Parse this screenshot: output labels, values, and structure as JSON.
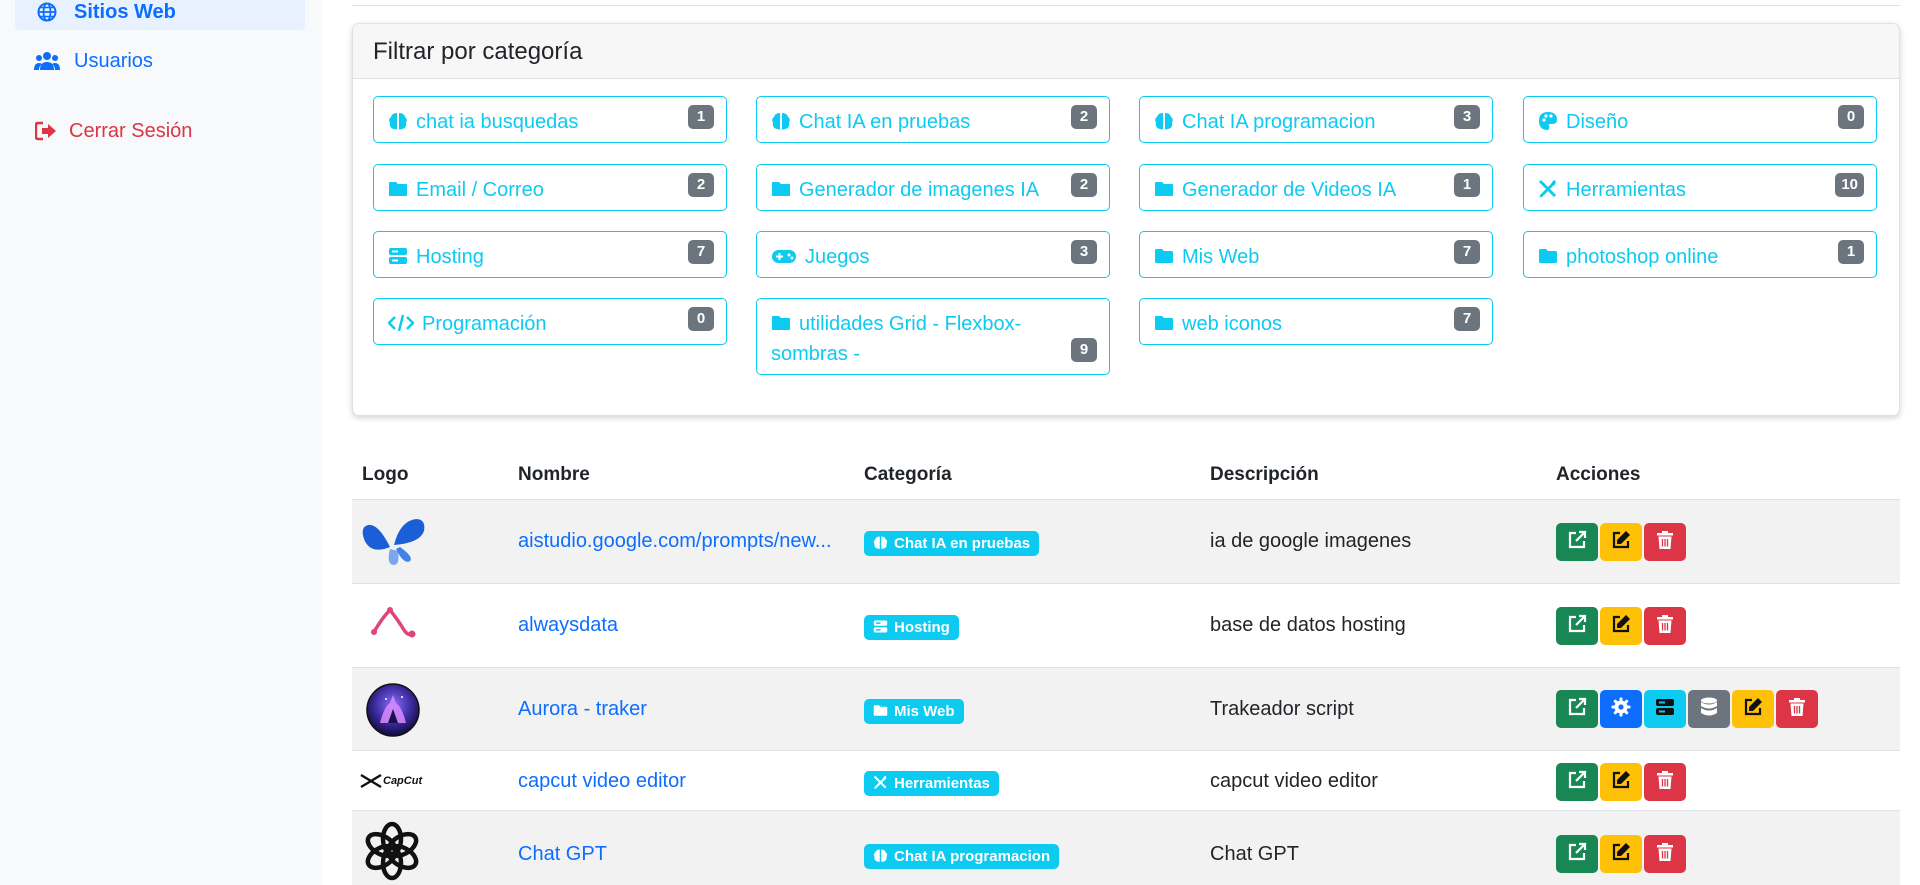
{
  "sidebar": {
    "items": [
      {
        "label": "Sitios Web",
        "icon": "globe-icon"
      },
      {
        "label": "Usuarios",
        "icon": "users-icon"
      },
      {
        "label": "Cerrar Sesión",
        "icon": "logout-icon"
      }
    ]
  },
  "filter": {
    "title": "Filtrar por categoría",
    "categories": [
      {
        "label": "chat ia busquedas",
        "count": "1",
        "icon": "brain-icon"
      },
      {
        "label": "Chat IA en pruebas",
        "count": "2",
        "icon": "brain-icon"
      },
      {
        "label": "Chat IA programacion",
        "count": "3",
        "icon": "brain-icon"
      },
      {
        "label": "Diseño",
        "count": "0",
        "icon": "palette-icon"
      },
      {
        "label": "Email / Correo",
        "count": "2",
        "icon": "folder-icon"
      },
      {
        "label": "Generador de imagenes IA",
        "count": "2",
        "icon": "folder-icon"
      },
      {
        "label": "Generador de Videos IA",
        "count": "1",
        "icon": "folder-icon"
      },
      {
        "label": "Herramientas",
        "count": "10",
        "icon": "tools-icon"
      },
      {
        "label": "Hosting",
        "count": "7",
        "icon": "server-icon"
      },
      {
        "label": "Juegos",
        "count": "3",
        "icon": "gamepad-icon"
      },
      {
        "label": "Mis Web",
        "count": "7",
        "icon": "folder-icon"
      },
      {
        "label": "photoshop online",
        "count": "1",
        "icon": "folder-icon"
      },
      {
        "label": "Programación",
        "count": "0",
        "icon": "code-icon"
      },
      {
        "label": "utilidades Grid - Flexbox- sombras -",
        "count": "9",
        "icon": "folder-icon"
      },
      {
        "label": "web iconos",
        "count": "7",
        "icon": "folder-icon"
      }
    ]
  },
  "table": {
    "headers": {
      "logo": "Logo",
      "name": "Nombre",
      "category": "Categoría",
      "description": "Descripción",
      "actions": "Acciones"
    },
    "rows": [
      {
        "name": "aistudio.google.com/prompts/new...",
        "category": "Chat IA en pruebas",
        "category_icon": "brain-icon",
        "description": "ia de google imagenes",
        "logo": "aistudio-logo"
      },
      {
        "name": "alwaysdata",
        "category": "Hosting",
        "category_icon": "server-icon",
        "description": "base de datos hosting",
        "logo": "alwaysdata-logo"
      },
      {
        "name": "Aurora - traker",
        "category": "Mis Web",
        "category_icon": "folder-icon",
        "description": "Trakeador script",
        "logo": "aurora-logo"
      },
      {
        "name": "capcut video editor",
        "category": "Herramientas",
        "category_icon": "tools-icon",
        "description": "capcut video editor",
        "logo": "capcut-logo",
        "logo_text": "CapCut"
      },
      {
        "name": "Chat GPT",
        "category": "Chat IA programacion",
        "category_icon": "brain-icon",
        "description": "Chat GPT",
        "logo": "openai-logo"
      }
    ]
  },
  "colors": {
    "primary": "#0d6efd",
    "info": "#0dcaf0",
    "success": "#198754",
    "warning": "#ffc107",
    "danger": "#dc3545",
    "secondary": "#6c757d"
  }
}
